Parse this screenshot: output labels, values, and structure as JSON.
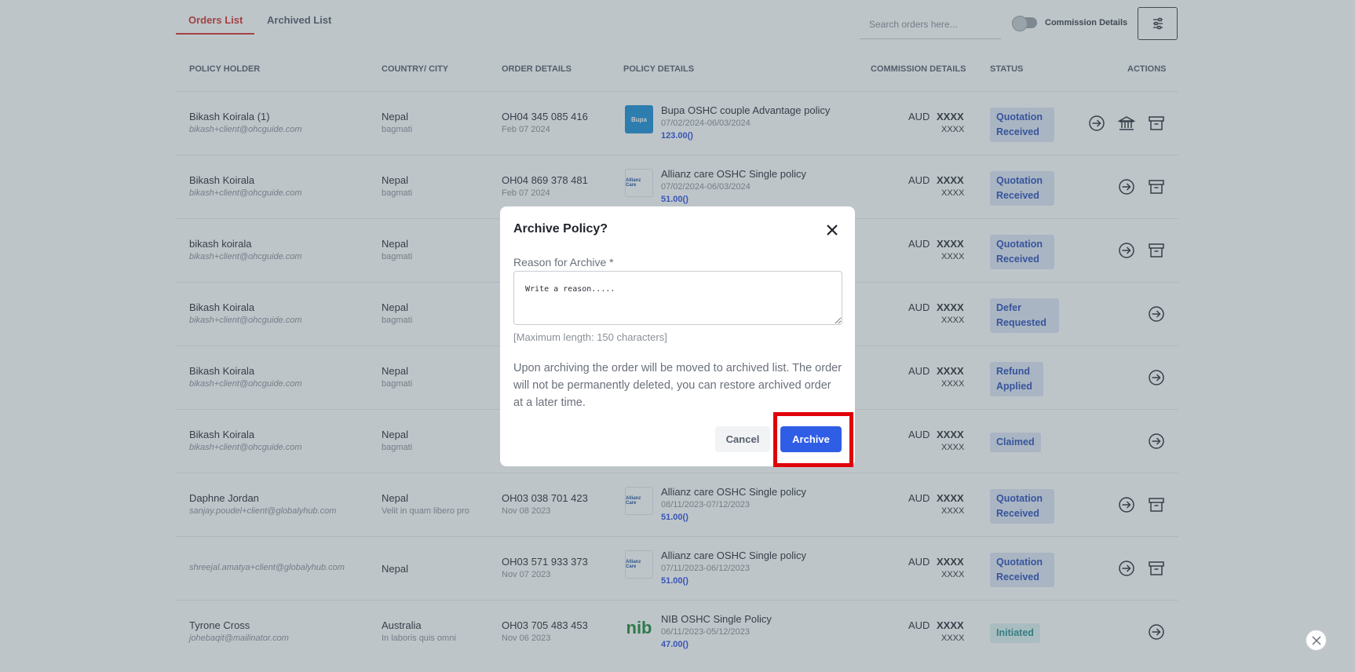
{
  "tabs": {
    "orders": "Orders List",
    "archived": "Archived List"
  },
  "search": {
    "placeholder": "Search orders here..."
  },
  "toggle": {
    "label": "Commission Details"
  },
  "columns": [
    "POLICY HOLDER",
    "COUNTRY/ CITY",
    "ORDER DETAILS",
    "POLICY DETAILS",
    "COMMISSION DETAILS",
    "STATUS",
    "ACTIONS"
  ],
  "rows": [
    {
      "name": "Bikash Koirala (1)",
      "email": "bikash+client@ohcguide.com",
      "country": "Nepal",
      "city": "bagmati",
      "order_no": "OH04 345 085 416",
      "order_date": "Feb 07 2024",
      "logo": "Bupa",
      "policy": "Bupa OSHC couple Advantage policy",
      "dates": "07/02/2024-06/03/2024",
      "price": "123.00()",
      "currency": "AUD",
      "commission": "XXXX",
      "commission_sub": "XXXX",
      "status": "Quotation Received",
      "actions": [
        "arrow-right-icon",
        "bank-icon",
        "archive-icon"
      ]
    },
    {
      "name": "Bikash Koirala",
      "email": "bikash+client@ohcguide.com",
      "country": "Nepal",
      "city": "bagmati",
      "order_no": "OH04 869 378 481",
      "order_date": "Feb 07 2024",
      "logo": "Allianz Care",
      "policy": "Allianz care OSHC Single policy",
      "dates": "07/02/2024-06/03/2024",
      "price": "51.00()",
      "currency": "AUD",
      "commission": "XXXX",
      "commission_sub": "XXXX",
      "status": "Quotation Received",
      "actions": [
        "arrow-right-icon",
        "archive-icon"
      ]
    },
    {
      "name": "bikash koirala",
      "email": "bikash+client@ohcguide.com",
      "country": "Nepal",
      "city": "bagmati",
      "currency": "AUD",
      "commission": "XXXX",
      "commission_sub": "XXXX",
      "status": "Quotation Received",
      "actions": [
        "arrow-right-icon",
        "archive-icon"
      ]
    },
    {
      "name": "Bikash Koirala",
      "email": "bikash+client@ohcguide.com",
      "country": "Nepal",
      "city": "bagmati",
      "currency": "AUD",
      "commission": "XXXX",
      "commission_sub": "XXXX",
      "status": "Defer Requested",
      "actions": [
        "arrow-right-icon"
      ]
    },
    {
      "name": "Bikash Koirala",
      "email": "bikash+client@ohcguide.com",
      "country": "Nepal",
      "city": "bagmati",
      "currency": "AUD",
      "commission": "XXXX",
      "commission_sub": "XXXX",
      "status": "Refund Applied",
      "actions": [
        "arrow-right-icon"
      ]
    },
    {
      "name": "Bikash Koirala",
      "email": "bikash+client@ohcguide.com",
      "country": "Nepal",
      "city": "bagmati",
      "currency": "AUD",
      "commission": "XXXX",
      "commission_sub": "XXXX",
      "status": "Claimed",
      "actions": [
        "arrow-right-icon"
      ]
    },
    {
      "name": "Daphne Jordan",
      "email": "sanjay.poudel+client@globalyhub.com",
      "country": "Nepal",
      "city": "Velit in quam libero pro",
      "order_no": "OH03 038 701 423",
      "order_date": "Nov 08 2023",
      "logo": "Allianz Care",
      "policy": "Allianz care OSHC Single policy",
      "dates": "08/11/2023-07/12/2023",
      "price": "51.00()",
      "currency": "AUD",
      "commission": "XXXX",
      "commission_sub": "XXXX",
      "status": "Quotation Received",
      "actions": [
        "arrow-right-icon",
        "archive-icon"
      ]
    },
    {
      "name": "",
      "email": "shreejal.amatya+client@globalyhub.com",
      "country": "Nepal",
      "city": "",
      "order_no": "OH03 571 933 373",
      "order_date": "Nov 07 2023",
      "logo": "Allianz Care",
      "policy": "Allianz care OSHC Single policy",
      "dates": "07/11/2023-06/12/2023",
      "price": "51.00()",
      "currency": "AUD",
      "commission": "XXXX",
      "commission_sub": "XXXX",
      "status": "Quotation Received",
      "actions": [
        "arrow-right-icon",
        "archive-icon"
      ]
    },
    {
      "name": "Tyrone Cross",
      "email": "johebaqit@mailinator.com",
      "country": "Australia",
      "city": "In laboris quis omni",
      "order_no": "OH03 705 483 453",
      "order_date": "Nov 06 2023",
      "logo": "nib",
      "policy": "NIB OSHC Single Policy",
      "dates": "06/11/2023-05/12/2023",
      "price": "47.00()",
      "currency": "AUD",
      "commission": "XXXX",
      "commission_sub": "XXXX",
      "status": "Initiated",
      "actions": [
        "arrow-right-icon"
      ]
    }
  ],
  "modal": {
    "title": "Archive Policy?",
    "field_label": "Reason for Archive *",
    "reason_placeholder": "Write a reason.....",
    "max_length": "[Maximum length: 150 characters]",
    "notice": "Upon archiving the order will be moved to archived list. The order will not be permanently deleted, you can restore archived order at a later time.",
    "cancel_label": "Cancel",
    "archive_label": "Archive"
  },
  "colors": {
    "accent": "#2f5de6",
    "tab_active": "#d2332f",
    "highlight": "#e0000a"
  }
}
